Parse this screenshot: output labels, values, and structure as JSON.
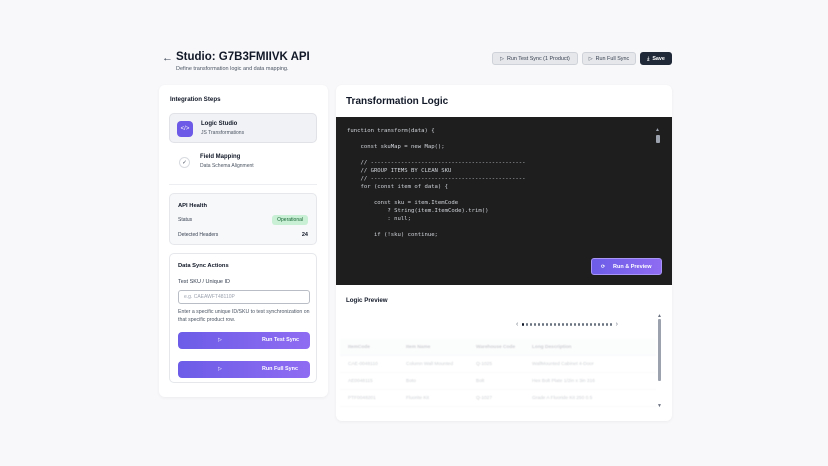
{
  "header": {
    "back_icon": "←",
    "title": "Studio: G7B3FMIIVK API",
    "subtitle": "Define transformation logic and data mapping.",
    "buttons": {
      "run_test_sync": "Run Test Sync (1 Product)",
      "run_full_sync": "Run Full Sync",
      "save": "Save"
    }
  },
  "sidebar": {
    "steps_title": "Integration Steps",
    "steps": [
      {
        "name": "Logic Studio",
        "desc": "JS Transformations",
        "icon": "code-icon",
        "glyph": "</>"
      },
      {
        "name": "Field Mapping",
        "desc": "Data Schema Alignment",
        "icon": "check-circle-icon",
        "glyph": "✓"
      }
    ],
    "api_health": {
      "title": "API Health",
      "status_label": "Status",
      "status_value": "Operational",
      "headers_label": "Detected Headers",
      "headers_value": "24"
    },
    "sync_actions": {
      "title": "Data Sync Actions",
      "input_label": "Test SKU / Unique ID",
      "input_placeholder": "e.g. CAEAWFT48110P",
      "input_value": "",
      "help_text": "Enter a specific unique ID/SKU to test synchronization on that specific product row.",
      "run_test_label": "Run Test Sync",
      "run_full_label": "Run Full Sync",
      "play_glyph": "▷"
    }
  },
  "main": {
    "title": "Transformation Logic",
    "code_lines": [
      "function transform(data) {",
      "",
      "    const skuMap = new Map();",
      "",
      "    // ----------------------------------------------",
      "    // GROUP ITEMS BY CLEAN SKU",
      "    // ----------------------------------------------",
      "    for (const item of data) {",
      "",
      "        const sku = item.ItemCode",
      "            ? String(item.ItemCode).trim()",
      "            : null;",
      "",
      "        if (!sku) continue;"
    ],
    "run_preview_label": "Run & Preview",
    "preview_title": "Logic Preview",
    "pager_count": 23,
    "pager_current": 0,
    "preview_table": {
      "headers": [
        "ItemCode",
        "Item Name",
        "Warehouse Code",
        "Long Description"
      ],
      "rows": [
        [
          "CAE-0048110",
          "Column Wall Mounted",
          "Q-1025",
          "WallMounted Cabinet 4-Door"
        ],
        [
          "AE0048115",
          "Boto",
          "Bolt",
          "Hex Bolt Plate 1/2in x 3in 316"
        ],
        [
          "PTF0048201",
          "Fluorite Kit",
          "Q-1027",
          "Grade A Fluoride Kit 250 0.5"
        ]
      ]
    }
  },
  "colors": {
    "accent": "#6c5ce7",
    "editor_bg": "#1e1e1e",
    "success_bg": "#c9f0d5"
  }
}
